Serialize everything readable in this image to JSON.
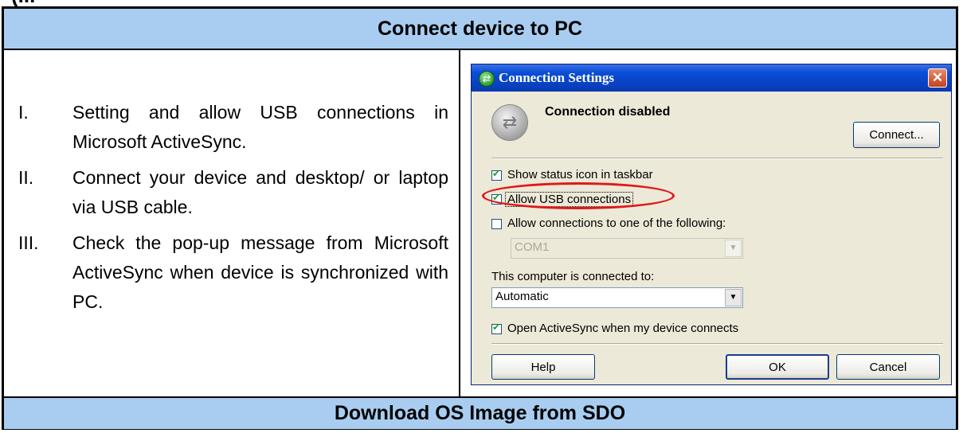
{
  "page_top_fragment": "(...",
  "section1_title": "Connect device to PC",
  "section2_title": "Download OS Image from SDO",
  "steps": [
    {
      "num": "I.",
      "text": "Setting and allow USB connections in Microsoft ActiveSync."
    },
    {
      "num": "II.",
      "text": "Connect your device and desktop/ or laptop via USB cable."
    },
    {
      "num": "III.",
      "text": "Check the pop-up message from Microsoft ActiveSync when device is synchronized with PC."
    }
  ],
  "dialog": {
    "title": "Connection Settings",
    "close_glyph": "✕",
    "status_text": "Connection disabled",
    "connect_button": "Connect...",
    "options": {
      "show_status_icon": {
        "label": "Show status icon in taskbar",
        "checked": true
      },
      "allow_usb": {
        "label": "Allow USB connections",
        "checked": true
      },
      "allow_com": {
        "label": "Allow connections to one of the following:",
        "checked": false
      },
      "open_activesync": {
        "label": "Open ActiveSync when my device connects",
        "checked": true
      }
    },
    "com_port_value": "COM1",
    "connected_to_label": "This computer is connected to:",
    "connected_to_value": "Automatic",
    "help_button": "Help",
    "ok_button": "OK",
    "cancel_button": "Cancel"
  },
  "colors": {
    "header_bg": "#a8cdf0",
    "highlight_ellipse": "#e01818",
    "titlebar": "#0a4ed6",
    "dialog_bg": "#ece9d8"
  }
}
